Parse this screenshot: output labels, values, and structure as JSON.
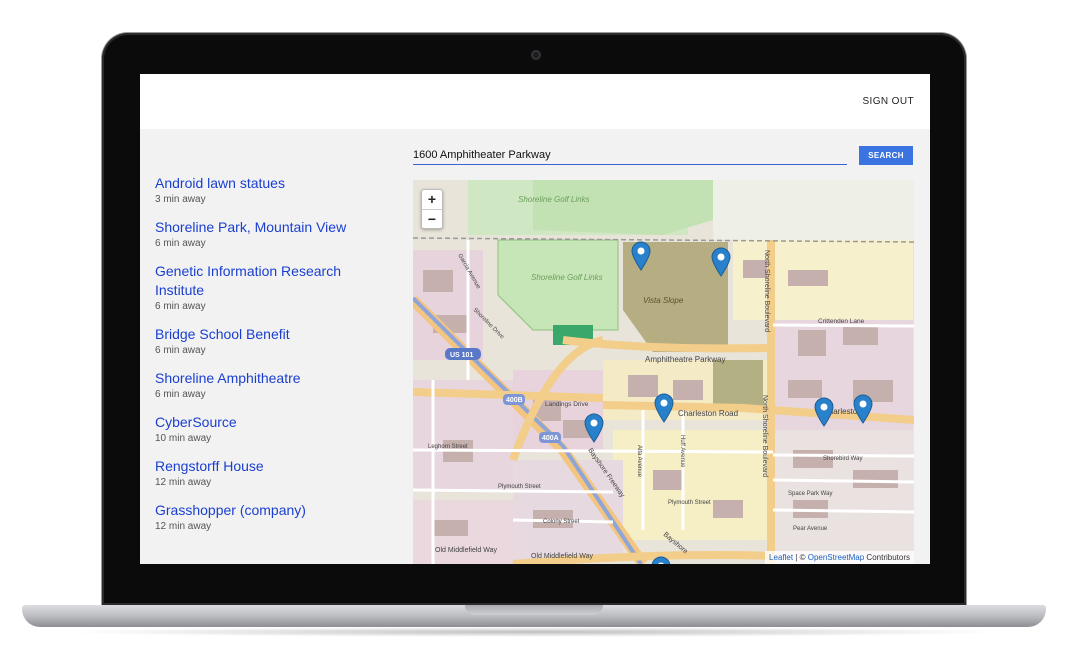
{
  "header": {
    "sign_out_label": "SIGN OUT"
  },
  "search": {
    "value": "1600 Amphitheater Parkway",
    "button_label": "SEARCH"
  },
  "results": [
    {
      "name": "Android lawn statues",
      "time": "3 min away"
    },
    {
      "name": "Shoreline Park, Mountain View",
      "time": "6 min away"
    },
    {
      "name": "Genetic Information Research Institute",
      "time": "6 min away"
    },
    {
      "name": "Bridge School Benefit",
      "time": "6 min away"
    },
    {
      "name": "Shoreline Amphitheatre",
      "time": "6 min away"
    },
    {
      "name": "CyberSource",
      "time": "10 min away"
    },
    {
      "name": "Rengstorff House",
      "time": "12 min away"
    },
    {
      "name": "Grasshopper (company)",
      "time": "12 min away"
    }
  ],
  "map": {
    "zoom_in": "+",
    "zoom_out": "−",
    "attribution": {
      "leaflet": "Leaflet",
      "separator": " | © ",
      "osm": "OpenStreetMap",
      "suffix": " Contributors"
    },
    "labels": {
      "golf1": "Shoreline Golf Links",
      "golf2": "Shoreline Golf Links",
      "vista": "Vista Slope",
      "amphitheatre": "Amphitheatre Parkway",
      "charleston1": "Charleston Road",
      "charleston2": "Charleston",
      "north_shoreline1": "North Shoreline Boulevard",
      "north_shoreline2": "North Shoreline Boulevard",
      "crittenden": "Crittenden Lane",
      "us101": "US 101",
      "hwy400b": "400B",
      "hwy400a": "400A",
      "bayshore1": "Bayshore Freeway",
      "bayshore2": "Bayshore",
      "landings": "Landings Drive",
      "leghorn": "Leghorn Street",
      "plymouth1": "Plymouth Street",
      "plymouth2": "Plymouth Street",
      "colony": "Colony Street",
      "old_middlefield1": "Old Middlefield Way",
      "old_middlefield2": "Old Middlefield Way",
      "shorebird": "Shorebird Way",
      "space_park": "Space Park Way",
      "pear": "Pear Avenue",
      "huff": "Huff Avenue",
      "alta": "Alta Avenue",
      "garcia": "Garcia Avenue",
      "shoreline_drive": "Shoreline Drive"
    }
  },
  "colors": {
    "accent": "#3b73e0",
    "link": "#1a3fd0",
    "marker": "#2a81cb"
  }
}
